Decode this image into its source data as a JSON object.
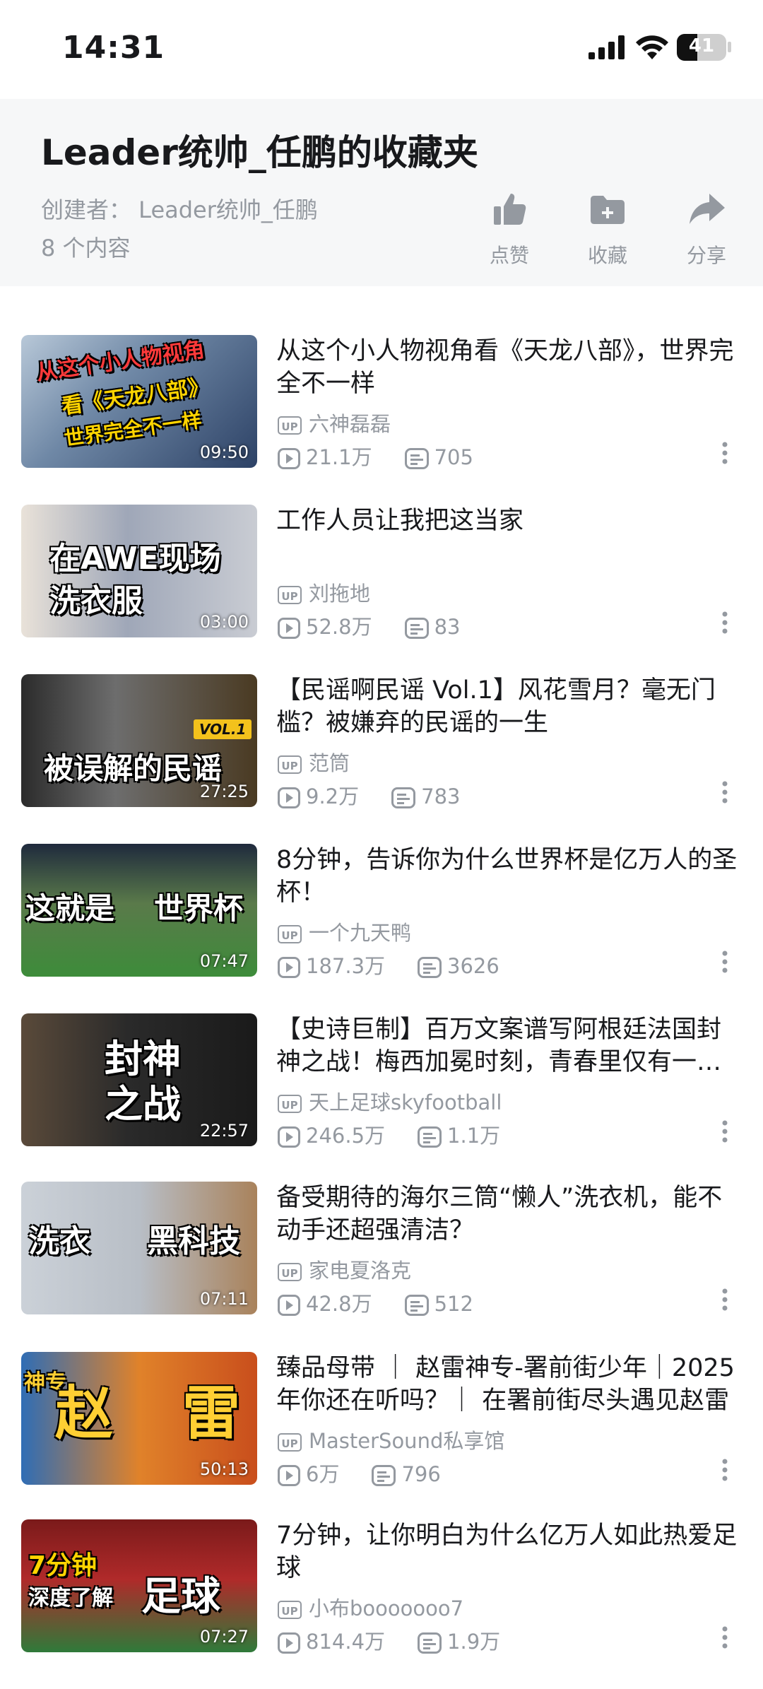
{
  "status": {
    "time": "14:31",
    "battery": "41",
    "battery_level": 0.41
  },
  "header": {
    "title": "Leader统帅_任鹏的收藏夹",
    "creator": "创建者：  Leader统帅_任鹏",
    "count": "8 个内容",
    "actions": {
      "like": "点赞",
      "collect": "收藏",
      "share": "分享"
    }
  },
  "videos": [
    {
      "title": "从这个小人物视角看《天龙八部》，世界完全不一样",
      "up": "六神磊磊",
      "views": "21.1万",
      "danmaku": "705",
      "duration": "09:50",
      "thumb_caption": "从这个小人物视角 看《天龙八部》 世界完全不一样"
    },
    {
      "title": "工作人员让我把这当家",
      "up": "刘拖地",
      "views": "52.8万",
      "danmaku": "83",
      "duration": "03:00",
      "thumb_caption": "在AWE现场 洗衣服"
    },
    {
      "title": "【民谣啊民谣  Vol.1】风花雪月？毫无门槛？被嫌弃的民谣的一生",
      "up": "范筒",
      "views": "9.2万",
      "danmaku": "783",
      "duration": "27:25",
      "thumb_caption": "被误解的民谣",
      "thumb_badge": "VOL.1"
    },
    {
      "title": "8分钟，告诉你为什么世界杯是亿万人的圣杯！",
      "up": "一个九天鸭",
      "views": "187.3万",
      "danmaku": "3626",
      "duration": "07:47",
      "thumb_caption": "这就是 世界杯"
    },
    {
      "title": "【史诗巨制】百万文案谱写阿根廷法国封神之战！梅西加冕时刻，青春里仅有一次的绝世对决",
      "up": "天上足球skyfootball",
      "views": "246.5万",
      "danmaku": "1.1万",
      "duration": "22:57",
      "thumb_caption": "封神 之战"
    },
    {
      "title": "备受期待的海尔三筒“懒人”洗衣机，能不动手还超强清洁？",
      "up": "家电夏洛克",
      "views": "42.8万",
      "danmaku": "512",
      "duration": "07:11",
      "thumb_caption": "洗衣 黑科技"
    },
    {
      "title": "臻品母带 ｜ 赵雷神专-署前街少年｜2025年你还在听吗？｜ 在署前街尽头遇见赵雷",
      "up": "MasterSound私享馆",
      "views": "6万",
      "danmaku": "796",
      "duration": "50:13",
      "thumb_caption": "神专 赵 雷"
    },
    {
      "title": "7分钟，让你明白为什么亿万人如此热爱足球",
      "up": "小布booooooo7",
      "views": "814.4万",
      "danmaku": "1.9万",
      "duration": "07:27",
      "thumb_caption": "7分钟 深度了解 足球"
    }
  ],
  "colors": {
    "text": "#18191c",
    "muted": "#9499a0",
    "header_bg": "#f6f7f8"
  }
}
